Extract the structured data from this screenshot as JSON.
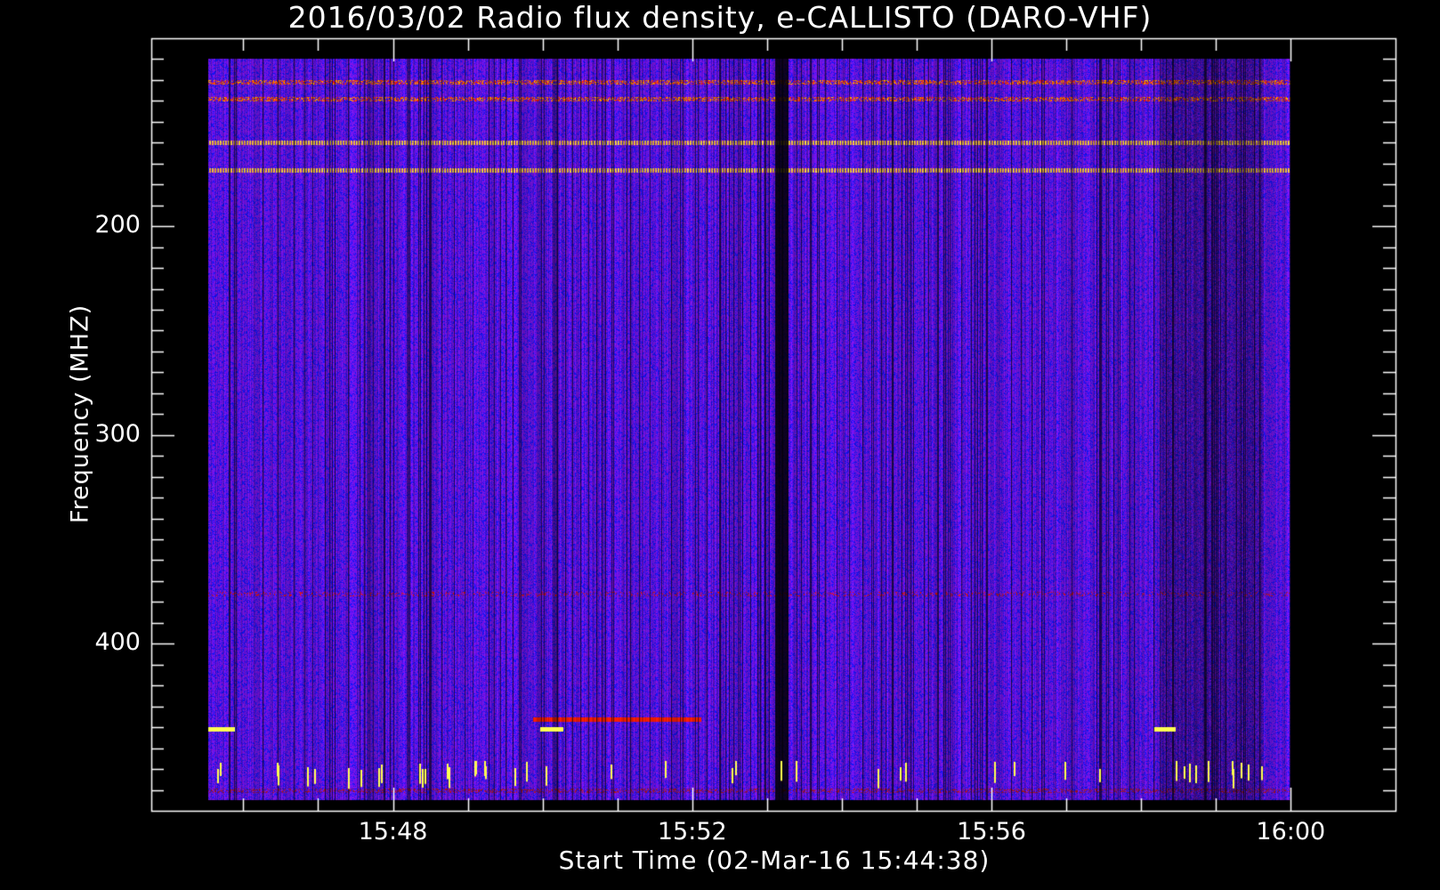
{
  "chart_data": {
    "type": "heatmap",
    "title": "2016/03/02  Radio flux density, e-CALLISTO (DARO-VHF)",
    "xlabel": "Start Time (02-Mar-16 15:44:38)",
    "ylabel": "Frequency (MHZ)",
    "x_tick_labels": [
      "15:48",
      "15:52",
      "15:56",
      "16:00"
    ],
    "x_tick_minutes": [
      228,
      232,
      236,
      240
    ],
    "x_range_minutes": [
      224.77,
      241.4
    ],
    "x_data_span_minutes": [
      225.53,
      240.0
    ],
    "y_tick_labels": [
      "200",
      "300",
      "400"
    ],
    "y_tick_values": [
      200,
      300,
      400
    ],
    "y_range": [
      110,
      480
    ],
    "y_reversed": true,
    "y_data_span": [
      120,
      475
    ],
    "colormap": [
      "#000000",
      "#0000cc",
      "#2020ff",
      "#6a2aa0",
      "#b01010",
      "#ff3000",
      "#ff9000",
      "#ffff40"
    ],
    "interference_lines_mhz": [
      131,
      139,
      160,
      167,
      173,
      376,
      436,
      470
    ],
    "dropout_minutes": [
      233.2,
      239.0
    ]
  },
  "colors": {
    "background": "#000000",
    "axes": "#ffffff",
    "text": "#ffffff"
  }
}
